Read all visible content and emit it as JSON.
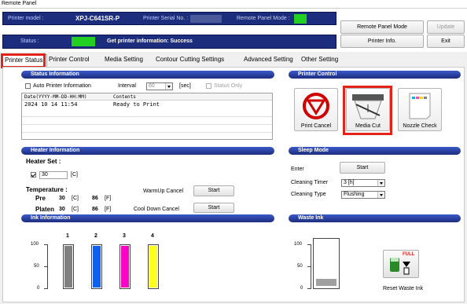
{
  "window": {
    "title": "Remote Panel"
  },
  "header": {
    "printer_model_label": "Printer model :",
    "printer_model_value": "XPJ-C641SR-P",
    "serial_label": "Printer Serial No. :",
    "remote_mode_label": "Remote Panel Mode :",
    "status_label": "Status :",
    "status_message": "Get printer information: Success",
    "remote_mode_indicator_color": "#22d022",
    "status_indicator_color": "#22d022",
    "buttons": {
      "remote_panel_mode": "Remote Panel Mode",
      "update": "Update",
      "printer_info": "Printer Info.",
      "exit": "Exit"
    }
  },
  "tabs": [
    {
      "label": "Printer Status",
      "active": true
    },
    {
      "label": "Printer Control",
      "active": false
    },
    {
      "label": "Media Setting",
      "active": false
    },
    {
      "label": "Contour Cutting Settings",
      "active": false
    },
    {
      "label": "Advanced Setting",
      "active": false
    },
    {
      "label": "Other Setting",
      "active": false
    }
  ],
  "status_info": {
    "title": "Status Information",
    "auto_label": "Auto Printer Information",
    "interval_label": "Interval",
    "interval_value": "60",
    "sec_label": "[sec]",
    "status_only_label": "Status Only",
    "log_columns": [
      "Date(YYYY-MM-DD-HH:MM)",
      "Contents"
    ],
    "log_rows": [
      {
        "date": "2024 10 14 11:54",
        "contents": "Ready to Print"
      }
    ]
  },
  "printer_control": {
    "title": "Printer Control",
    "buttons": [
      {
        "label": "Print Cancel",
        "icon": "print-cancel-icon"
      },
      {
        "label": "Media Cut",
        "icon": "media-cut-icon"
      },
      {
        "label": "Nozzle Check",
        "icon": "nozzle-check-icon"
      }
    ]
  },
  "heater": {
    "title": "Heater Information",
    "heater_set_label": "Heater Set :",
    "heater_set_value": "30",
    "unit_c": "[C]",
    "unit_f": "[F]",
    "temperature_label": "Temperature :",
    "pre_label": "Pre",
    "pre_c": "30",
    "pre_f": "86",
    "platen_label": "Platen",
    "platen_c": "30",
    "platen_f": "86",
    "warmup_label": "WarmUp Cancel",
    "cooldown_label": "Cool Down Cancel",
    "start_label": "Start"
  },
  "sleep_mode": {
    "title": "Sleep Mode",
    "enter_label": "Enter",
    "start_label": "Start",
    "cleaning_timer_label": "Cleaning Timer",
    "cleaning_timer_value": "3 [h]",
    "cleaning_type_label": "Cleaning Type",
    "cleaning_type_value": "Flushing"
  },
  "ink": {
    "title": "Ink Information",
    "scale": [
      "100",
      "50",
      "0"
    ],
    "channels": [
      {
        "number": "1",
        "color": "#808080",
        "level": 100
      },
      {
        "number": "2",
        "color": "#1060f0",
        "level": 100
      },
      {
        "number": "3",
        "color": "#ff00c8",
        "level": 100
      },
      {
        "number": "4",
        "color": "#ffff20",
        "level": 100
      }
    ]
  },
  "waste_ink": {
    "title": "Waste Ink",
    "scale": [
      "100",
      "50",
      "0"
    ],
    "fill_color": "#a0a0a0",
    "level": 15,
    "full_label": "FULL",
    "reset_label": "Reset Waste Ink"
  },
  "highlight_color": "#e2231a"
}
